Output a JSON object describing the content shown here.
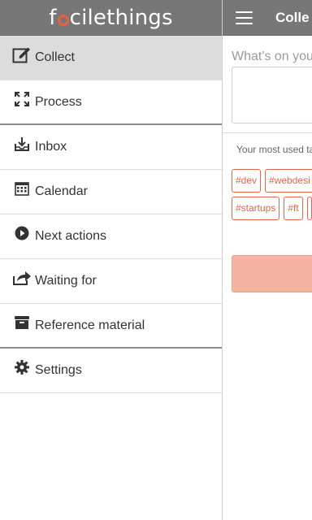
{
  "brand": {
    "logo_prefix": "f",
    "logo_suffix": "cilethings",
    "accent_color": "#e8603c"
  },
  "drawer": {
    "items": [
      {
        "label": "Collect",
        "icon": "edit-icon",
        "active": true
      },
      {
        "label": "Process",
        "icon": "expand-arrows-icon",
        "active": false
      },
      {
        "label": "Inbox",
        "icon": "inbox-tray-icon",
        "active": false
      },
      {
        "label": "Calendar",
        "icon": "calendar-icon",
        "active": false
      },
      {
        "label": "Next actions",
        "icon": "play-circle-icon",
        "active": false
      },
      {
        "label": "Waiting for",
        "icon": "share-icon",
        "active": false
      },
      {
        "label": "Reference material",
        "icon": "archive-icon",
        "active": false
      },
      {
        "label": "Settings",
        "icon": "gear-icon",
        "active": false
      }
    ]
  },
  "main": {
    "menu_icon": "hamburger-icon",
    "title": "Colle",
    "prompt_label": "What's on you",
    "note_value": "",
    "tags_caption": "Your most used ta",
    "tags_row1": [
      "#dev",
      "#webdesi"
    ],
    "tags_row2": [
      "#startups",
      "#ft"
    ]
  }
}
